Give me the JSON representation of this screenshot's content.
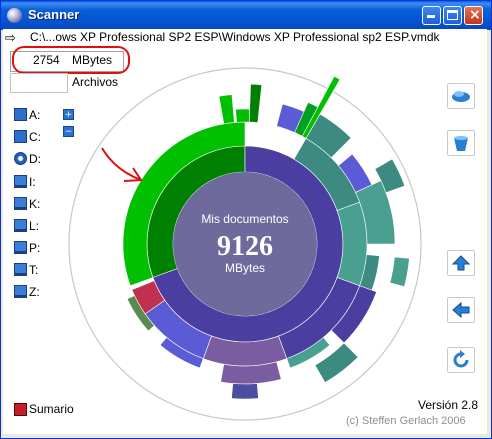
{
  "window": {
    "title": "Scanner"
  },
  "path": {
    "text": "C:\\...ows XP Professional SP2 ESP\\Windows XP Professional sp2 ESP.vmdk"
  },
  "size": {
    "value": "2754",
    "unit": "MBytes"
  },
  "files": {
    "label": "Archivos"
  },
  "drives": [
    {
      "label": "A:",
      "icon": "floppy-drive-icon"
    },
    {
      "label": "C:",
      "icon": "hard-drive-icon"
    },
    {
      "label": "D:",
      "icon": "cd-drive-icon"
    },
    {
      "label": "I:",
      "icon": "network-drive-icon"
    },
    {
      "label": "K:",
      "icon": "network-drive-icon"
    },
    {
      "label": "L:",
      "icon": "network-drive-icon"
    },
    {
      "label": "P:",
      "icon": "network-drive-icon"
    },
    {
      "label": "T:",
      "icon": "network-drive-icon"
    },
    {
      "label": "Z:",
      "icon": "network-drive-icon"
    }
  ],
  "center": {
    "name": "Mis documentos",
    "value": "9126",
    "unit": "MBytes"
  },
  "summary": {
    "label": "Sumario"
  },
  "version": "Versión 2.8",
  "copyright": "(c) Steffen Gerlach 2006",
  "colors": {
    "green": "#00c000",
    "darkgreen": "#008000",
    "purple": "#4a3fa0",
    "teal": "#3d8a80",
    "center": "#6e6a9c",
    "annotation": "#e01010"
  }
}
